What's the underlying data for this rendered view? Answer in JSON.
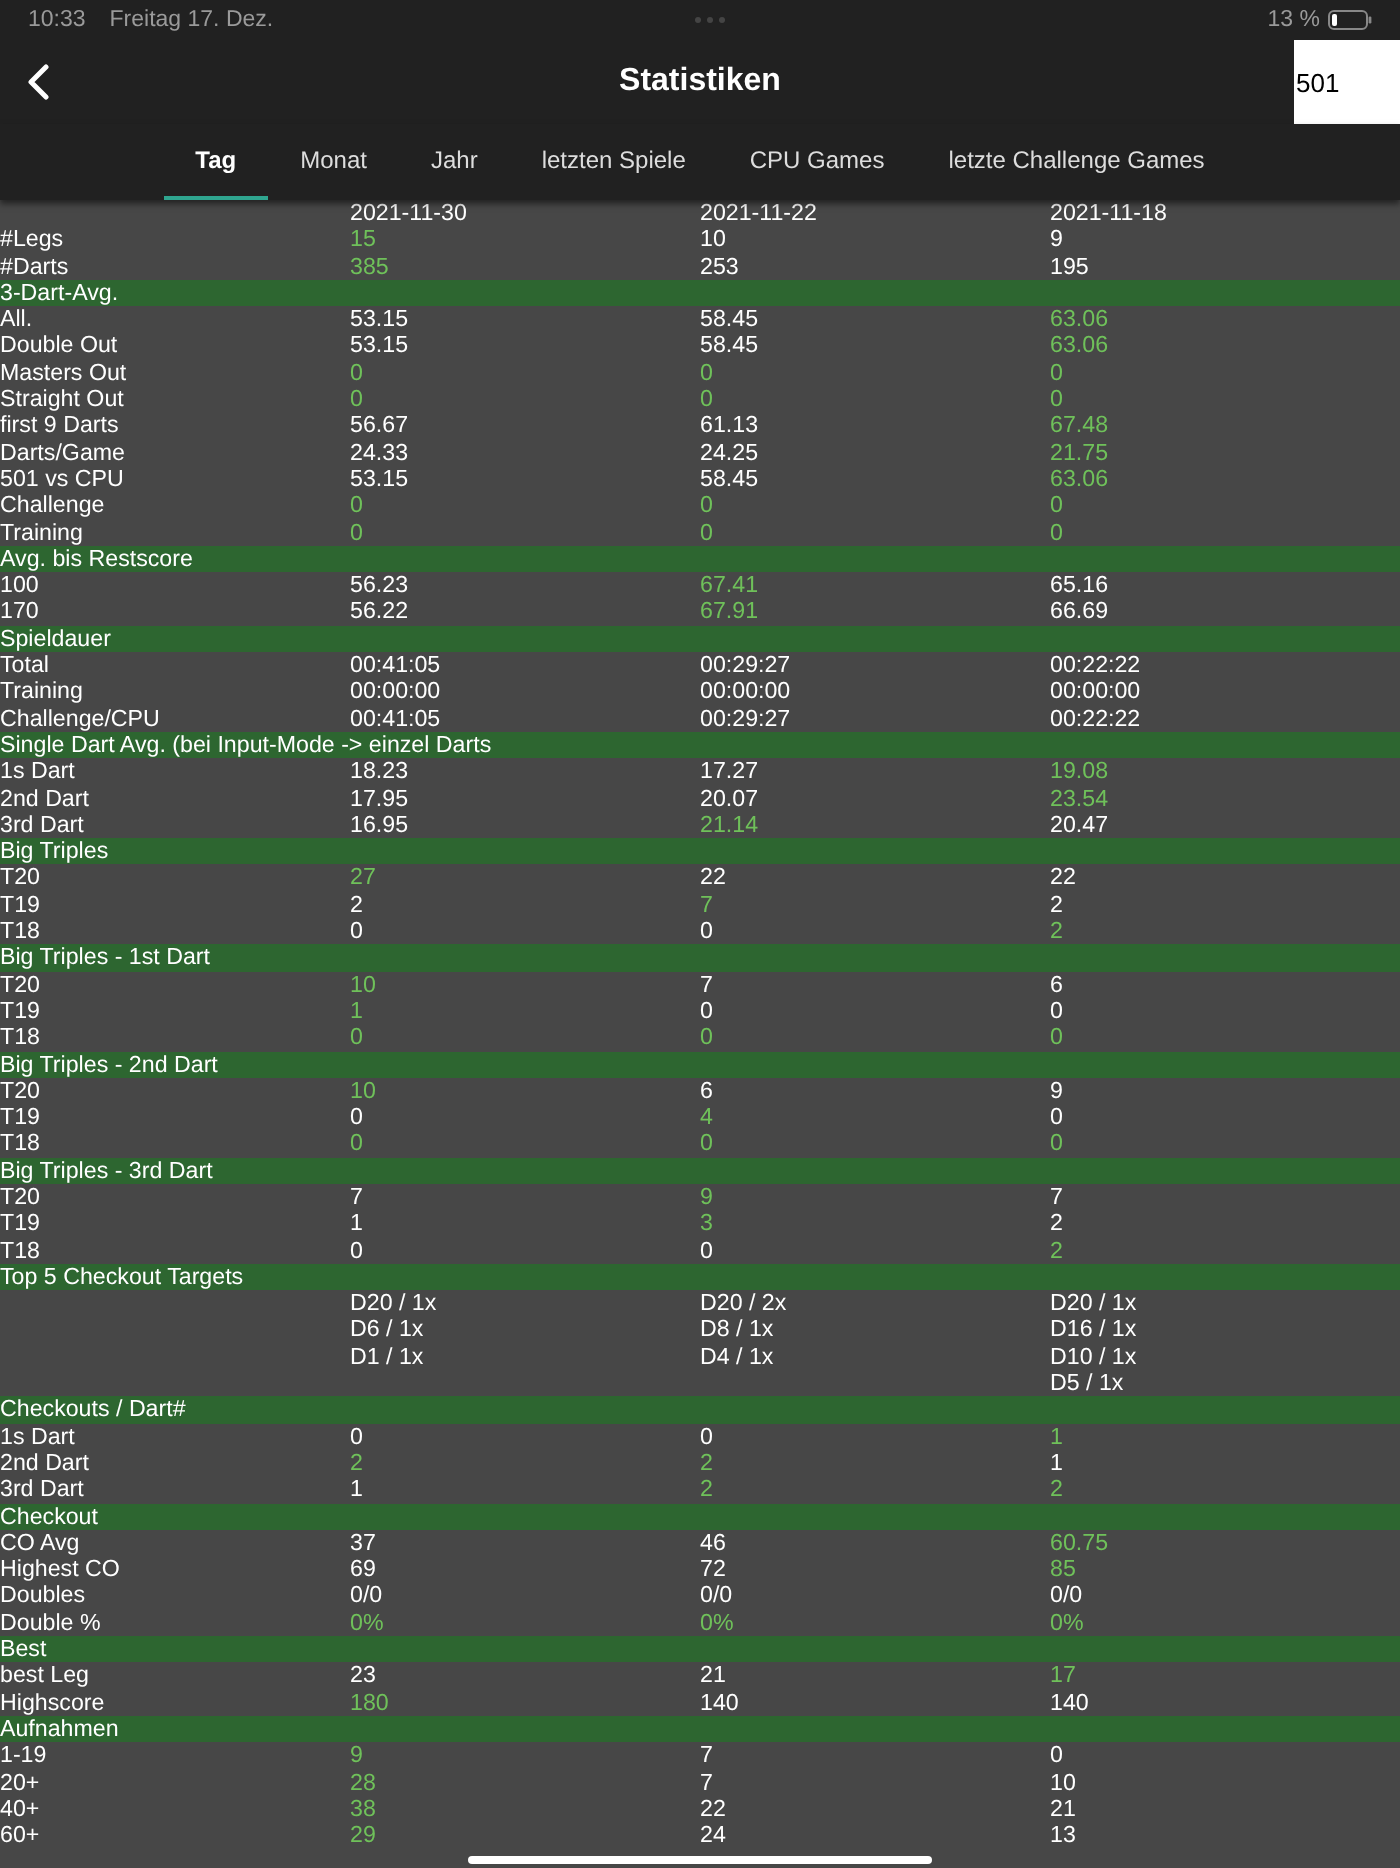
{
  "status_bar": {
    "time": "10:33",
    "date": "Freitag 17. Dez.",
    "battery": "13 %"
  },
  "header": {
    "title": "Statistiken",
    "game_field": "501"
  },
  "tabs": [
    {
      "label": "Tag",
      "selected": true
    },
    {
      "label": "Monat",
      "selected": false
    },
    {
      "label": "Jahr",
      "selected": false
    },
    {
      "label": "letzten Spiele",
      "selected": false
    },
    {
      "label": "CPU Games",
      "selected": false
    },
    {
      "label": "letzte Challenge Games",
      "selected": false
    }
  ],
  "table": {
    "dates": [
      "2021-11-30",
      "2021-11-22",
      "2021-11-18"
    ],
    "rows": [
      {
        "kind": "stat",
        "label": "#Legs",
        "values": [
          {
            "text": "15",
            "best": true
          },
          {
            "text": "10",
            "best": false
          },
          {
            "text": "9",
            "best": false
          }
        ]
      },
      {
        "kind": "stat",
        "label": "#Darts",
        "values": [
          {
            "text": "385",
            "best": true
          },
          {
            "text": "253",
            "best": false
          },
          {
            "text": "195",
            "best": false
          }
        ]
      },
      {
        "kind": "section",
        "label": "3-Dart-Avg."
      },
      {
        "kind": "stat",
        "label": "All.",
        "values": [
          {
            "text": "53.15",
            "best": false
          },
          {
            "text": "58.45",
            "best": false
          },
          {
            "text": "63.06",
            "best": true
          }
        ]
      },
      {
        "kind": "stat",
        "label": "Double Out",
        "values": [
          {
            "text": "53.15",
            "best": false
          },
          {
            "text": "58.45",
            "best": false
          },
          {
            "text": "63.06",
            "best": true
          }
        ]
      },
      {
        "kind": "stat",
        "label": "Masters Out",
        "values": [
          {
            "text": "0",
            "best": true
          },
          {
            "text": "0",
            "best": true
          },
          {
            "text": "0",
            "best": true
          }
        ]
      },
      {
        "kind": "stat",
        "label": "Straight Out",
        "values": [
          {
            "text": "0",
            "best": true
          },
          {
            "text": "0",
            "best": true
          },
          {
            "text": "0",
            "best": true
          }
        ]
      },
      {
        "kind": "stat",
        "label": "first 9 Darts",
        "values": [
          {
            "text": "56.67",
            "best": false
          },
          {
            "text": "61.13",
            "best": false
          },
          {
            "text": "67.48",
            "best": true
          }
        ]
      },
      {
        "kind": "stat",
        "label": "Darts/Game",
        "values": [
          {
            "text": "24.33",
            "best": false
          },
          {
            "text": "24.25",
            "best": false
          },
          {
            "text": "21.75",
            "best": true
          }
        ]
      },
      {
        "kind": "stat",
        "label": "501 vs CPU",
        "values": [
          {
            "text": "53.15",
            "best": false
          },
          {
            "text": "58.45",
            "best": false
          },
          {
            "text": "63.06",
            "best": true
          }
        ]
      },
      {
        "kind": "stat",
        "label": "Challenge",
        "values": [
          {
            "text": "0",
            "best": true
          },
          {
            "text": "0",
            "best": true
          },
          {
            "text": "0",
            "best": true
          }
        ]
      },
      {
        "kind": "stat",
        "label": "Training",
        "values": [
          {
            "text": "0",
            "best": true
          },
          {
            "text": "0",
            "best": true
          },
          {
            "text": "0",
            "best": true
          }
        ]
      },
      {
        "kind": "section",
        "label": "Avg. bis Restscore"
      },
      {
        "kind": "stat",
        "label": "100",
        "values": [
          {
            "text": "56.23",
            "best": false
          },
          {
            "text": "67.41",
            "best": true
          },
          {
            "text": "65.16",
            "best": false
          }
        ]
      },
      {
        "kind": "stat",
        "label": "170",
        "values": [
          {
            "text": "56.22",
            "best": false
          },
          {
            "text": "67.91",
            "best": true
          },
          {
            "text": "66.69",
            "best": false
          }
        ]
      },
      {
        "kind": "section",
        "label": "Spieldauer"
      },
      {
        "kind": "stat",
        "label": "Total",
        "values": [
          {
            "text": "00:41:05",
            "best": false
          },
          {
            "text": "00:29:27",
            "best": false
          },
          {
            "text": "00:22:22",
            "best": false
          }
        ]
      },
      {
        "kind": "stat",
        "label": "Training",
        "values": [
          {
            "text": "00:00:00",
            "best": false
          },
          {
            "text": "00:00:00",
            "best": false
          },
          {
            "text": "00:00:00",
            "best": false
          }
        ]
      },
      {
        "kind": "stat",
        "label": "Challenge/CPU",
        "values": [
          {
            "text": "00:41:05",
            "best": false
          },
          {
            "text": "00:29:27",
            "best": false
          },
          {
            "text": "00:22:22",
            "best": false
          }
        ]
      },
      {
        "kind": "section",
        "label": "Single Dart Avg. (bei Input-Mode -> einzel Darts"
      },
      {
        "kind": "stat",
        "label": "1s Dart",
        "values": [
          {
            "text": "18.23",
            "best": false
          },
          {
            "text": "17.27",
            "best": false
          },
          {
            "text": "19.08",
            "best": true
          }
        ]
      },
      {
        "kind": "stat",
        "label": "2nd Dart",
        "values": [
          {
            "text": "17.95",
            "best": false
          },
          {
            "text": "20.07",
            "best": false
          },
          {
            "text": "23.54",
            "best": true
          }
        ]
      },
      {
        "kind": "stat",
        "label": "3rd Dart",
        "values": [
          {
            "text": "16.95",
            "best": false
          },
          {
            "text": "21.14",
            "best": true
          },
          {
            "text": "20.47",
            "best": false
          }
        ]
      },
      {
        "kind": "section",
        "label": "Big Triples"
      },
      {
        "kind": "stat",
        "label": "T20",
        "values": [
          {
            "text": "27",
            "best": true
          },
          {
            "text": "22",
            "best": false
          },
          {
            "text": "22",
            "best": false
          }
        ]
      },
      {
        "kind": "stat",
        "label": "T19",
        "values": [
          {
            "text": "2",
            "best": false
          },
          {
            "text": "7",
            "best": true
          },
          {
            "text": "2",
            "best": false
          }
        ]
      },
      {
        "kind": "stat",
        "label": "T18",
        "values": [
          {
            "text": "0",
            "best": false
          },
          {
            "text": "0",
            "best": false
          },
          {
            "text": "2",
            "best": true
          }
        ]
      },
      {
        "kind": "section",
        "label": "Big Triples - 1st Dart"
      },
      {
        "kind": "stat",
        "label": "T20",
        "values": [
          {
            "text": "10",
            "best": true
          },
          {
            "text": "7",
            "best": false
          },
          {
            "text": "6",
            "best": false
          }
        ]
      },
      {
        "kind": "stat",
        "label": "T19",
        "values": [
          {
            "text": "1",
            "best": true
          },
          {
            "text": "0",
            "best": false
          },
          {
            "text": "0",
            "best": false
          }
        ]
      },
      {
        "kind": "stat",
        "label": "T18",
        "values": [
          {
            "text": "0",
            "best": true
          },
          {
            "text": "0",
            "best": true
          },
          {
            "text": "0",
            "best": true
          }
        ]
      },
      {
        "kind": "section",
        "label": "Big Triples - 2nd Dart"
      },
      {
        "kind": "stat",
        "label": "T20",
        "values": [
          {
            "text": "10",
            "best": true
          },
          {
            "text": "6",
            "best": false
          },
          {
            "text": "9",
            "best": false
          }
        ]
      },
      {
        "kind": "stat",
        "label": "T19",
        "values": [
          {
            "text": "0",
            "best": false
          },
          {
            "text": "4",
            "best": true
          },
          {
            "text": "0",
            "best": false
          }
        ]
      },
      {
        "kind": "stat",
        "label": "T18",
        "values": [
          {
            "text": "0",
            "best": true
          },
          {
            "text": "0",
            "best": true
          },
          {
            "text": "0",
            "best": true
          }
        ]
      },
      {
        "kind": "section",
        "label": "Big Triples -  3rd Dart"
      },
      {
        "kind": "stat",
        "label": "T20",
        "values": [
          {
            "text": "7",
            "best": false
          },
          {
            "text": "9",
            "best": true
          },
          {
            "text": "7",
            "best": false
          }
        ]
      },
      {
        "kind": "stat",
        "label": "T19",
        "values": [
          {
            "text": "1",
            "best": false
          },
          {
            "text": "3",
            "best": true
          },
          {
            "text": "2",
            "best": false
          }
        ]
      },
      {
        "kind": "stat",
        "label": "T18",
        "values": [
          {
            "text": "0",
            "best": false
          },
          {
            "text": "0",
            "best": false
          },
          {
            "text": "2",
            "best": true
          }
        ]
      },
      {
        "kind": "section",
        "label": "Top 5 Checkout Targets"
      },
      {
        "kind": "targets",
        "values": [
          [
            "D20 / 1x",
            "D6 / 1x",
            "D1 / 1x"
          ],
          [
            "D20 / 2x",
            "D8 / 1x",
            "D4 / 1x"
          ],
          [
            "D20 / 1x",
            "D16 / 1x",
            "D10 / 1x",
            "D5 / 1x"
          ]
        ]
      },
      {
        "kind": "section",
        "label": "Checkouts / Dart#"
      },
      {
        "kind": "stat",
        "label": "1s Dart",
        "values": [
          {
            "text": "0",
            "best": false
          },
          {
            "text": "0",
            "best": false
          },
          {
            "text": "1",
            "best": true
          }
        ]
      },
      {
        "kind": "stat",
        "label": "2nd Dart",
        "values": [
          {
            "text": "2",
            "best": true
          },
          {
            "text": "2",
            "best": true
          },
          {
            "text": "1",
            "best": false
          }
        ]
      },
      {
        "kind": "stat",
        "label": "3rd Dart",
        "values": [
          {
            "text": "1",
            "best": false
          },
          {
            "text": "2",
            "best": true
          },
          {
            "text": "2",
            "best": true
          }
        ]
      },
      {
        "kind": "section",
        "label": "Checkout"
      },
      {
        "kind": "stat",
        "label": "CO Avg",
        "values": [
          {
            "text": "37",
            "best": false
          },
          {
            "text": "46",
            "best": false
          },
          {
            "text": "60.75",
            "best": true
          }
        ]
      },
      {
        "kind": "stat",
        "label": "Highest CO",
        "values": [
          {
            "text": "69",
            "best": false
          },
          {
            "text": "72",
            "best": false
          },
          {
            "text": "85",
            "best": true
          }
        ]
      },
      {
        "kind": "stat",
        "label": "Doubles",
        "values": [
          {
            "text": "0/0",
            "best": false
          },
          {
            "text": "0/0",
            "best": false
          },
          {
            "text": "0/0",
            "best": false
          }
        ]
      },
      {
        "kind": "stat",
        "label": "Double %",
        "values": [
          {
            "text": "0%",
            "best": true
          },
          {
            "text": "0%",
            "best": true
          },
          {
            "text": "0%",
            "best": true
          }
        ]
      },
      {
        "kind": "section",
        "label": "Best"
      },
      {
        "kind": "stat",
        "label": "best Leg",
        "values": [
          {
            "text": "23",
            "best": false
          },
          {
            "text": "21",
            "best": false
          },
          {
            "text": "17",
            "best": true
          }
        ]
      },
      {
        "kind": "stat",
        "label": "Highscore",
        "values": [
          {
            "text": "180",
            "best": true
          },
          {
            "text": "140",
            "best": false
          },
          {
            "text": "140",
            "best": false
          }
        ]
      },
      {
        "kind": "section",
        "label": "Aufnahmen"
      },
      {
        "kind": "stat",
        "label": "1-19",
        "values": [
          {
            "text": "9",
            "best": true
          },
          {
            "text": "7",
            "best": false
          },
          {
            "text": "0",
            "best": false
          }
        ]
      },
      {
        "kind": "stat",
        "label": "20+",
        "values": [
          {
            "text": "28",
            "best": true
          },
          {
            "text": "7",
            "best": false
          },
          {
            "text": "10",
            "best": false
          }
        ]
      },
      {
        "kind": "stat",
        "label": "40+",
        "values": [
          {
            "text": "38",
            "best": true
          },
          {
            "text": "22",
            "best": false
          },
          {
            "text": "21",
            "best": false
          }
        ]
      },
      {
        "kind": "stat",
        "label": "60+",
        "values": [
          {
            "text": "29",
            "best": true
          },
          {
            "text": "24",
            "best": false
          },
          {
            "text": "13",
            "best": false
          }
        ]
      }
    ]
  }
}
